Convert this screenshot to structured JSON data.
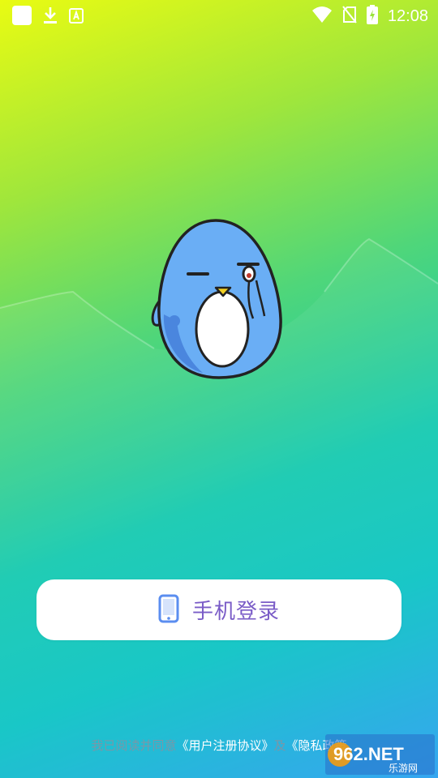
{
  "status_bar": {
    "time": "12:08",
    "left_icons": [
      "app-icon",
      "download-icon",
      "store-icon"
    ],
    "right_icons": [
      "wifi-icon",
      "no-sim-icon",
      "battery-charging-icon"
    ]
  },
  "login": {
    "button_label": "手机登录",
    "icon": "phone-icon"
  },
  "agreement": {
    "prefix": "我已阅读并同意",
    "user_agreement": "《用户注册协议》",
    "conjunction": "及",
    "privacy_policy": "《隐私政策"
  },
  "watermark": {
    "brand": "962.NET",
    "sub": "乐游网"
  },
  "colors": {
    "button_text": "#7a5cc7",
    "mascot_body": "#6aaef5"
  }
}
